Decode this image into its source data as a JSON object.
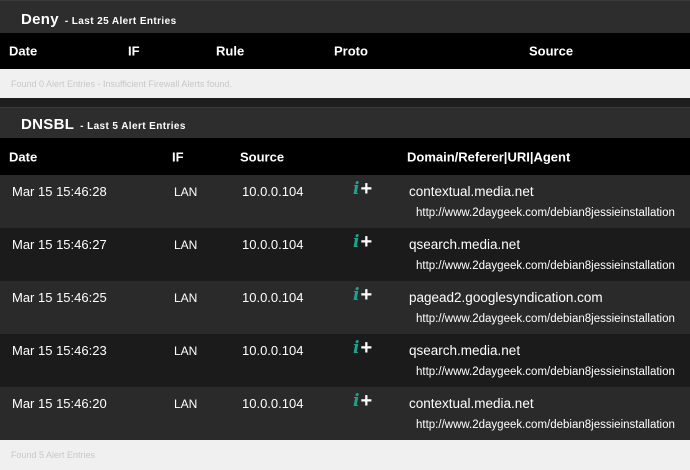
{
  "deny": {
    "title": "Deny",
    "subtitle": "- Last 25 Alert Entries",
    "columns": [
      "Date",
      "IF",
      "Rule",
      "Proto",
      "Source"
    ],
    "footer": "Found 0 Alert Entries - Insufficient Firewall Alerts found."
  },
  "dnsbl": {
    "title": "DNSBL",
    "subtitle": "- Last 5 Alert Entries",
    "columns": [
      "Date",
      "IF",
      "Source",
      "Domain/Referer|URI|Agent"
    ],
    "rows": [
      {
        "date": "Mar 15 15:46:28",
        "if": "LAN",
        "source": "10.0.0.104",
        "domain": "contextual.media.net",
        "url": "http://www.2daygeek.com/debian8jessieinstallation"
      },
      {
        "date": "Mar 15 15:46:27",
        "if": "LAN",
        "source": "10.0.0.104",
        "domain": "qsearch.media.net",
        "url": "http://www.2daygeek.com/debian8jessieinstallation"
      },
      {
        "date": "Mar 15 15:46:25",
        "if": "LAN",
        "source": "10.0.0.104",
        "domain": "pagead2.googlesyndication.com",
        "url": "http://www.2daygeek.com/debian8jessieinstallation"
      },
      {
        "date": "Mar 15 15:46:23",
        "if": "LAN",
        "source": "10.0.0.104",
        "domain": "qsearch.media.net",
        "url": "http://www.2daygeek.com/debian8jessieinstallation"
      },
      {
        "date": "Mar 15 15:46:20",
        "if": "LAN",
        "source": "10.0.0.104",
        "domain": "contextual.media.net",
        "url": "http://www.2daygeek.com/debian8jessieinstallation"
      }
    ],
    "footer": "Found 5 Alert Entries"
  },
  "icons": {
    "info": "i",
    "add": "+"
  },
  "colors": {
    "accent": "#1aa38f",
    "header_bg": "#000000",
    "panel_bg": "#2d2d2d",
    "footer_bg": "#f0f0f0"
  }
}
